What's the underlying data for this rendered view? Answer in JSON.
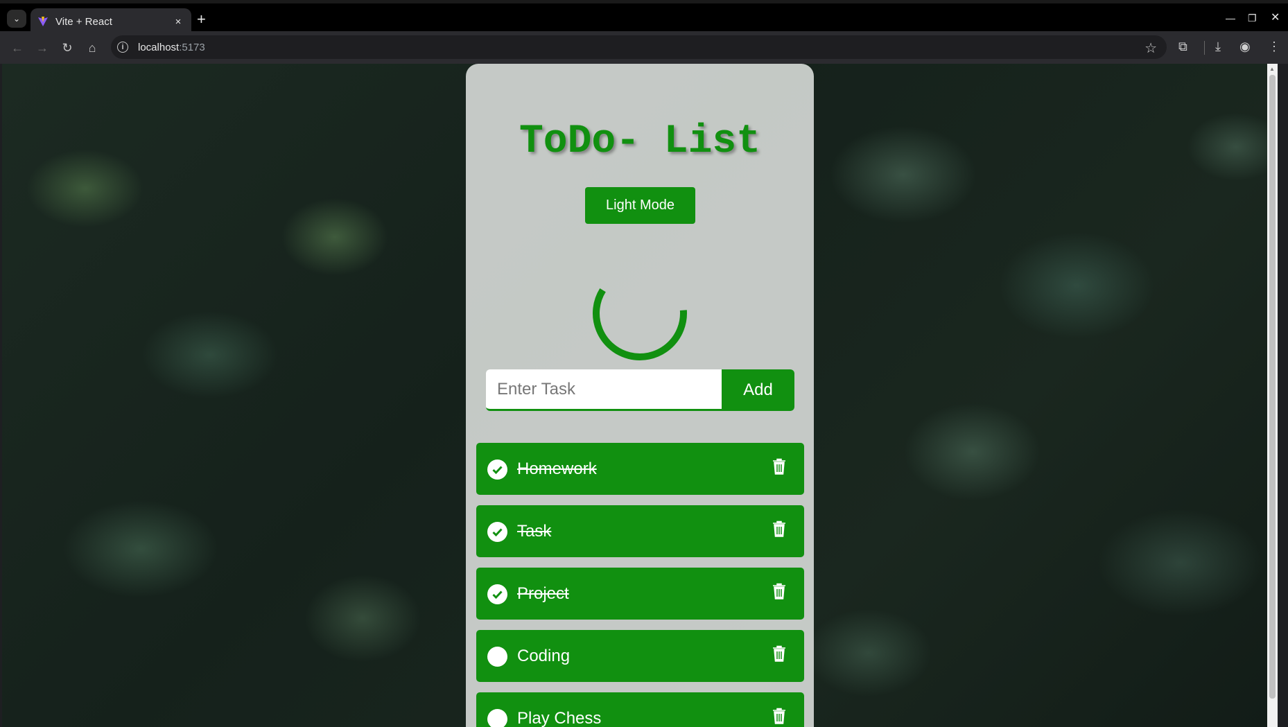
{
  "browser": {
    "tab_title": "Vite + React",
    "url_host": "localhost",
    "url_port": ":5173",
    "new_tab_symbol": "+",
    "tab_close_symbol": "×"
  },
  "app": {
    "title": "ToDo- List",
    "mode_button_label": "Light Mode",
    "progress_fraction": 0.6,
    "input_placeholder": "Enter Task",
    "add_button_label": "Add",
    "accent_color": "#119010"
  },
  "tasks": [
    {
      "label": "Homework",
      "completed": true
    },
    {
      "label": "Task",
      "completed": true
    },
    {
      "label": "Project",
      "completed": true
    },
    {
      "label": "Coding",
      "completed": false
    },
    {
      "label": "Play Chess",
      "completed": false
    }
  ],
  "icons": {
    "check": "check-circle-icon",
    "empty": "empty-circle-icon",
    "delete": "trash-icon"
  }
}
